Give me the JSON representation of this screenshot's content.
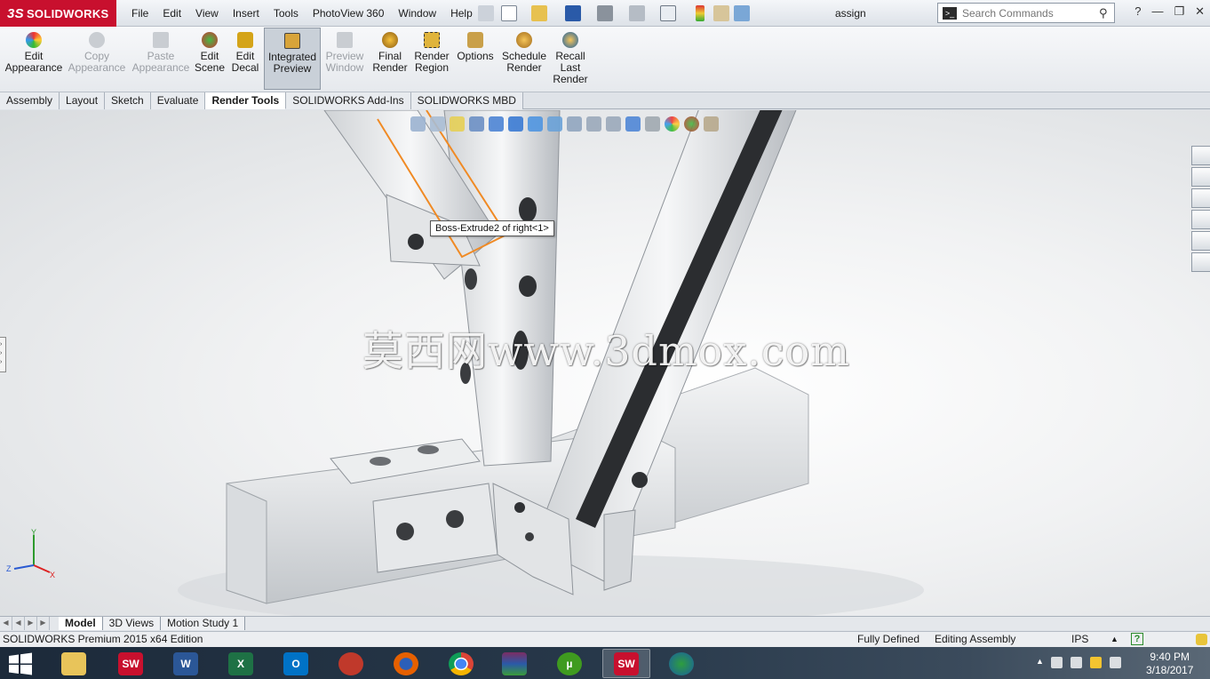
{
  "app": {
    "brand": "SOLIDWORKS",
    "document_title": "assign",
    "accent_color": "#c8102e"
  },
  "menu": [
    "File",
    "Edit",
    "View",
    "Insert",
    "Tools",
    "PhotoView 360",
    "Window",
    "Help"
  ],
  "search": {
    "placeholder": "Search Commands"
  },
  "ribbon": [
    {
      "label": "Edit Appearance",
      "icon": "appearance-icon",
      "enabled": true
    },
    {
      "label": "Copy Appearance",
      "icon": "copy-appearance-icon",
      "enabled": false
    },
    {
      "label": "Paste Appearance",
      "icon": "paste-appearance-icon",
      "enabled": false
    },
    {
      "label": "Edit Scene",
      "icon": "scene-icon",
      "enabled": true
    },
    {
      "label": "Edit Decal",
      "icon": "decal-icon",
      "enabled": true
    },
    {
      "label": "Integrated Preview",
      "icon": "integrated-preview-icon",
      "enabled": true,
      "active": true
    },
    {
      "label": "Preview Window",
      "icon": "preview-window-icon",
      "enabled": false
    },
    {
      "label": "Final Render",
      "icon": "final-render-icon",
      "enabled": true
    },
    {
      "label": "Render Region",
      "icon": "render-region-icon",
      "enabled": true
    },
    {
      "label": "Options",
      "icon": "options-icon",
      "enabled": true
    },
    {
      "label": "Schedule Render",
      "icon": "schedule-render-icon",
      "enabled": true
    },
    {
      "label": "Recall Last Render",
      "icon": "recall-render-icon",
      "enabled": true
    }
  ],
  "command_tabs": [
    {
      "label": "Assembly",
      "active": false
    },
    {
      "label": "Layout",
      "active": false
    },
    {
      "label": "Sketch",
      "active": false
    },
    {
      "label": "Evaluate",
      "active": false
    },
    {
      "label": "Render Tools",
      "active": true
    },
    {
      "label": "SOLIDWORKS Add-Ins",
      "active": false
    },
    {
      "label": "SOLIDWORKS MBD",
      "active": false
    }
  ],
  "viewport": {
    "tooltip": "Boss-Extrude2 of right<1>",
    "watermark": "莫西网www.3dmox.com",
    "triad": {
      "x": "X",
      "y": "Y",
      "z": "Z"
    }
  },
  "model_tabs": [
    {
      "label": "Model",
      "active": true
    },
    {
      "label": "3D Views",
      "active": false
    },
    {
      "label": "Motion Study 1",
      "active": false
    }
  ],
  "status": {
    "edition": "SOLIDWORKS Premium 2015 x64 Edition",
    "definition": "Fully Defined",
    "mode": "Editing Assembly",
    "units": "IPS",
    "help_icon": "?"
  },
  "taskbar": {
    "apps": [
      {
        "name": "file-explorer",
        "label": "",
        "color": "#e8c45a"
      },
      {
        "name": "solidworks-2015",
        "label": "SW",
        "color": "#c8102e"
      },
      {
        "name": "word",
        "label": "W",
        "color": "#2b5797"
      },
      {
        "name": "excel",
        "label": "X",
        "color": "#1e7145"
      },
      {
        "name": "outlook",
        "label": "O",
        "color": "#0072c6"
      },
      {
        "name": "ccleaner",
        "label": "",
        "color": "#c0392b"
      },
      {
        "name": "firefox",
        "label": "",
        "color": "#e66000"
      },
      {
        "name": "chrome",
        "label": "",
        "color": "#4285f4"
      },
      {
        "name": "winrar",
        "label": "",
        "color": "#7b2d63"
      },
      {
        "name": "utorrent",
        "label": "µ",
        "color": "#3f9b1f"
      },
      {
        "name": "solidworks-2015-active",
        "label": "SW",
        "color": "#c8102e",
        "active": true
      },
      {
        "name": "download-manager",
        "label": "",
        "color": "#2e9e3e"
      }
    ],
    "time": "9:40 PM",
    "date": "3/18/2017"
  }
}
